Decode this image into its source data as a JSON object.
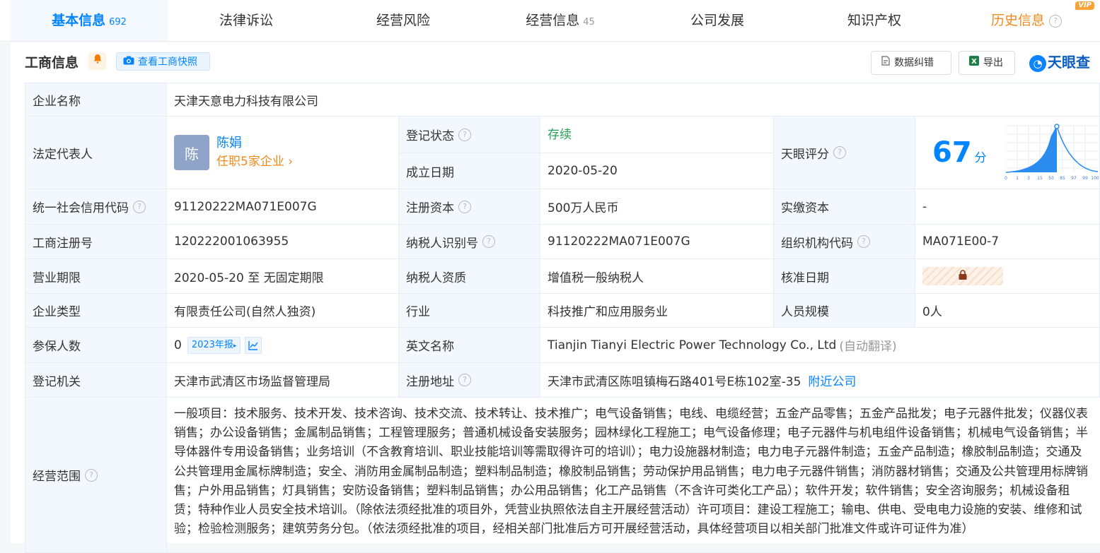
{
  "tabs": [
    {
      "label": "基本信息",
      "count": "692"
    },
    {
      "label": "法律诉讼",
      "count": ""
    },
    {
      "label": "经营风险",
      "count": ""
    },
    {
      "label": "经营信息",
      "count": "45"
    },
    {
      "label": "公司发展",
      "count": ""
    },
    {
      "label": "知识产权",
      "count": ""
    },
    {
      "label": "历史信息",
      "count": ""
    }
  ],
  "vip_badge": "VIP",
  "help_glyph": "?",
  "section": {
    "title": "工商信息",
    "snapshot_button": "查看工商快照",
    "correct_button": "数据纠错",
    "export_button": "导出",
    "logo_text": "天眼查"
  },
  "rows": {
    "company_name": {
      "label": "企业名称",
      "value": "天津天意电力科技有限公司"
    },
    "legal_rep": {
      "label": "法定代表人",
      "avatar": "陈",
      "name": "陈娟",
      "positions": "任职5家企业"
    },
    "reg_status": {
      "label": "登记状态",
      "value": "存续"
    },
    "founded": {
      "label": "成立日期",
      "value": "2020-05-20"
    },
    "tianyan_score": {
      "label": "天眼评分",
      "value": "67",
      "unit": "分",
      "ticks": [
        "0",
        "1",
        "3",
        "15",
        "50",
        "85",
        "97",
        "99",
        "100"
      ]
    },
    "credit_code": {
      "label": "统一社会信用代码",
      "value": "91120222MA071E007G"
    },
    "reg_capital": {
      "label": "注册资本",
      "value": "500万人民币"
    },
    "paid_capital": {
      "label": "实缴资本",
      "value": "-"
    },
    "reg_no": {
      "label": "工商注册号",
      "value": "120222001063955"
    },
    "taxpayer_id": {
      "label": "纳税人识别号",
      "value": "91120222MA071E007G"
    },
    "org_code": {
      "label": "组织机构代码",
      "value": "MA071E00-7"
    },
    "term": {
      "label": "营业期限",
      "value": "2020-05-20 至 无固定期限"
    },
    "taxpayer_qual": {
      "label": "纳税人资质",
      "value": "增值税一般纳税人"
    },
    "approval_date": {
      "label": "核准日期"
    },
    "company_type": {
      "label": "企业类型",
      "value": "有限责任公司(自然人独资)"
    },
    "industry": {
      "label": "行业",
      "value": "科技推广和应用服务业"
    },
    "staff_size": {
      "label": "人员规模",
      "value": "0人"
    },
    "insured": {
      "label": "参保人数",
      "value": "0",
      "report": "2023年报"
    },
    "english_name": {
      "label": "英文名称",
      "value": "Tianjin Tianyi Electric Power Technology Co., Ltd",
      "note": "(自动翻译)"
    },
    "authority": {
      "label": "登记机关",
      "value": "天津市武清区市场监督管理局"
    },
    "address": {
      "label": "注册地址",
      "value": "天津市武清区陈咀镇梅石路401号E栋102室-35",
      "link": "附近公司"
    },
    "scope": {
      "label": "经营范围",
      "value": "一般项目：技术服务、技术开发、技术咨询、技术交流、技术转让、技术推广；电气设备销售；电线、电缆经营；五金产品零售；五金产品批发；电子元器件批发；仪器仪表销售；办公设备销售；金属制品销售；工程管理服务；普通机械设备安装服务；园林绿化工程施工；电气设备修理；电子元器件与机电组件设备销售；机械电气设备销售；半导体器件专用设备销售；业务培训（不含教育培训、职业技能培训等需取得许可的培训）；电力设施器材制造；电力电子元器件制造；五金产品制造；橡胶制品制造；交通及公共管理用金属标牌制造；安全、消防用金属制品制造；塑料制品制造；橡胶制品销售；劳动保护用品销售；电力电子元器件销售；消防器材销售；交通及公共管理用标牌销售；户外用品销售；灯具销售；安防设备销售；塑料制品销售；办公用品销售；化工产品销售（不含许可类化工产品）；软件开发；软件销售；安全咨询服务；机械设备租赁；特种作业人员安全技术培训。（除依法须经批准的项目外，凭营业执照依法自主开展经营活动）许可项目：建设工程施工；输电、供电、受电电力设施的安装、维修和试验；检验检测服务；建筑劳务分包。（依法须经批准的项目，经相关部门批准后方可开展经营活动，具体经营项目以相关部门批准文件或许可证件为准）"
    }
  }
}
